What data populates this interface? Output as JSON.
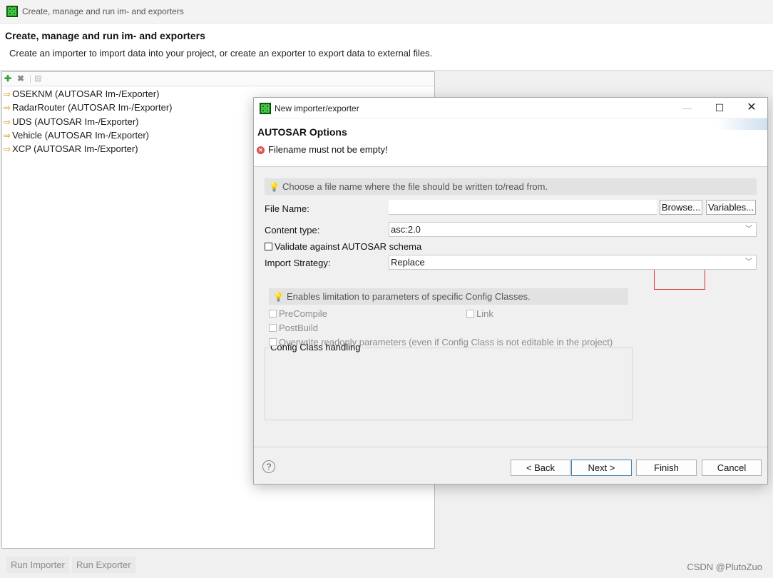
{
  "main": {
    "window_title": "Create, manage and run im- and exporters",
    "header_title": "Create, manage and run im- and exporters",
    "header_description": "Create an importer to import data into your project, or create an exporter to export data to external files.",
    "items": [
      {
        "label": "OSEKNM (AUTOSAR Im-/Exporter)"
      },
      {
        "label": "RadarRouter (AUTOSAR Im-/Exporter)"
      },
      {
        "label": "UDS (AUTOSAR Im-/Exporter)"
      },
      {
        "label": "Vehicle (AUTOSAR Im-/Exporter)"
      },
      {
        "label": "XCP (AUTOSAR Im-/Exporter)"
      }
    ],
    "run_importer_label": "Run Importer",
    "run_exporter_label": "Run Exporter"
  },
  "dialog": {
    "title": "New importer/exporter",
    "section_title": "AUTOSAR Options",
    "error_message": "Filename must not be empty!",
    "file_hint": "Choose a file name where the file should be written to/read from.",
    "file_name_label": "File Name:",
    "file_name_value": "",
    "browse_label": "Browse...",
    "variables_label": "Variables...",
    "content_type_label": "Content type:",
    "content_type_value": "asc:2.0",
    "validate_label": "Validate against AUTOSAR schema",
    "validate_checked": false,
    "import_strategy_label": "Import Strategy:",
    "import_strategy_value": "Replace",
    "config_group_label": "Config Class handling",
    "config_hint": "Enables limitation to parameters of specific Config Classes.",
    "precompile_label": "PreCompile",
    "link_label": "Link",
    "postbuild_label": "PostBuild",
    "overwrite_label": "Overwrite readonly parameters (even if Config Class is not editable in the project)",
    "help_symbol": "?",
    "back_label": "< Back",
    "next_label": "Next >",
    "finish_label": "Finish",
    "cancel_label": "Cancel"
  },
  "watermark": "CSDN @PlutoZuo"
}
